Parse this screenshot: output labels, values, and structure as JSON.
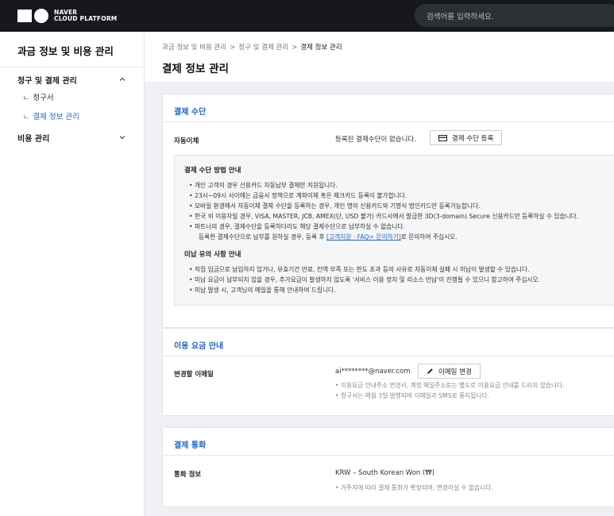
{
  "topbar": {
    "logo_line1": "NAVER",
    "logo_line2": "CLOUD PLATFORM",
    "search_placeholder": "검색어를 입력하세요."
  },
  "sidebar": {
    "title": "과금 정보 및 비용 관리",
    "groups": [
      {
        "label": "청구 및 결제 관리",
        "expanded": true,
        "items": [
          {
            "label": "청구서",
            "active": false
          },
          {
            "label": "결제 정보 관리",
            "active": true
          }
        ]
      },
      {
        "label": "비용 관리",
        "expanded": false
      }
    ],
    "sub_mark": "ㄴ"
  },
  "breadcrumb": [
    "과금 정보 및 비용 관리",
    "청구 및 결제 관리",
    "결제 정보 관리"
  ],
  "breadcrumb_sep": ">",
  "page_title": "결제 정보 관리",
  "payment": {
    "title": "결제 수단",
    "row_label": "자동이체",
    "status": "등록된 결제수단이 없습니다.",
    "register_button": "결제 수단 등록",
    "guide_title": "결제 수단 방법 안내",
    "guide_items": [
      "• 개인 고객의 경우 신용카드 자동납부 결제만 지원됩니다.",
      "• 23시~09시 사이에는 금융사 정책으로 계좌이체 혹은 체크카드 등록이 불가합니다.",
      "• 모바일 환경에서 자동이체 결제 수단을 등록하는 경우, 개인 명의 신용카드와 기명식 법인카드만 등록가능합니다.",
      "• 한국 외 이용자일 경우, VISA, MASTER, JCB, AMEX(단, USD 불가) 카드사에서 발급한 3D(3-domain) Secure 신용카드만 등록하실 수 있습니다.",
      "• 파트너의 경우, 결제수단을 등록하더라도 해당 결제수단으로 납부하실 수 없습니다."
    ],
    "guide_partner_pre": "등록한 결제수단으로 납부를 원하실 경우, 등록 후 ",
    "guide_partner_link": "[고객지원 · FAQ> 문의하기]",
    "guide_partner_post": "로 문의하여 주십시오.",
    "notice_title": "미납 유의 사항 안내",
    "notice_items": [
      "• 직접 입금으로 납입하지 않거나, 유효기간 만료, 잔액 부족 또는 한도 초과 등의 사유로 자동이체 실패 시 미납이 발생할 수 있습니다.",
      "• 미납 요금이 납부되지 않을 경우, 추가요금이 발생하지 않도록 '서비스 이용 정지 및 리소스 반납'이 진행될 수 있으니 참고하여 주십시오.",
      "• 미납 발생 시, 고객님의 메일을 통해 안내하여 드립니다."
    ]
  },
  "billing": {
    "title": "이용 요금 안내",
    "row_label": "변경할 이메일",
    "email": "ai********@naver.com",
    "change_button": "이메일 변경",
    "notes": [
      "• 이용요금 안내주소 변경시, 계정 메일주소로는 별도로 이용요금 안내를 드리지 않습니다.",
      "• 청구서는 매월 3일 발행되며 이메일과 SMS로 통지됩니다."
    ]
  },
  "currency": {
    "title": "결제 통화",
    "row_label": "통화 정보",
    "value": "KRW – South Korean Won (₩)",
    "note": "• 거주지에 따라 결제 통화가 확정되며, 변경하실 수 없습니다."
  }
}
